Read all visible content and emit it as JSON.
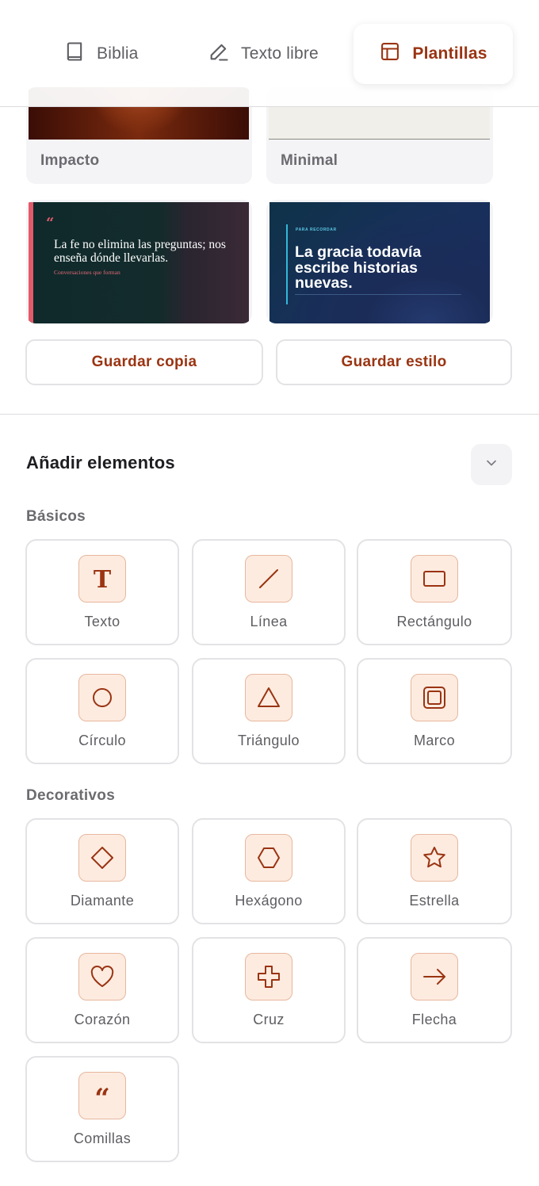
{
  "tabs": [
    {
      "label": "Biblia",
      "icon": "book-icon"
    },
    {
      "label": "Texto libre",
      "icon": "pencil-icon"
    },
    {
      "label": "Plantillas",
      "icon": "layout-icon",
      "active": true
    }
  ],
  "templates": {
    "impacto": {
      "label": "Impacto"
    },
    "minimal": {
      "label": "Minimal"
    },
    "conversaciones": {
      "quote_mark": "“",
      "quote": "La fe no elimina las preguntas; nos enseña dónde llevarlas.",
      "source": "Conversaciones que forman"
    },
    "gracia": {
      "kicker": "PARA RECORDAR",
      "headline": "La gracia todavía escribe historias nuevas."
    }
  },
  "actions": {
    "save_copy": "Guardar copia",
    "save_style": "Guardar estilo"
  },
  "add_elements": {
    "title": "Añadir elementos",
    "basic": {
      "title": "Básicos",
      "items": [
        {
          "label": "Texto",
          "icon": "text-icon"
        },
        {
          "label": "Línea",
          "icon": "line-icon"
        },
        {
          "label": "Rectángulo",
          "icon": "rectangle-icon"
        },
        {
          "label": "Círculo",
          "icon": "circle-icon"
        },
        {
          "label": "Triángulo",
          "icon": "triangle-icon"
        },
        {
          "label": "Marco",
          "icon": "frame-icon"
        }
      ]
    },
    "decorative": {
      "title": "Decorativos",
      "items": [
        {
          "label": "Diamante",
          "icon": "diamond-icon"
        },
        {
          "label": "Hexágono",
          "icon": "hexagon-icon"
        },
        {
          "label": "Estrella",
          "icon": "star-icon"
        },
        {
          "label": "Corazón",
          "icon": "heart-icon"
        },
        {
          "label": "Cruz",
          "icon": "cross-icon"
        },
        {
          "label": "Flecha",
          "icon": "arrow-right-icon"
        },
        {
          "label": "Comillas",
          "icon": "quotes-icon"
        }
      ]
    }
  },
  "colors": {
    "accent": "#9a3412",
    "icon_bg": "#fdebe0",
    "icon_border": "#e7b79d",
    "border": "#e3e3e6",
    "muted_text": "#6b6b70"
  }
}
